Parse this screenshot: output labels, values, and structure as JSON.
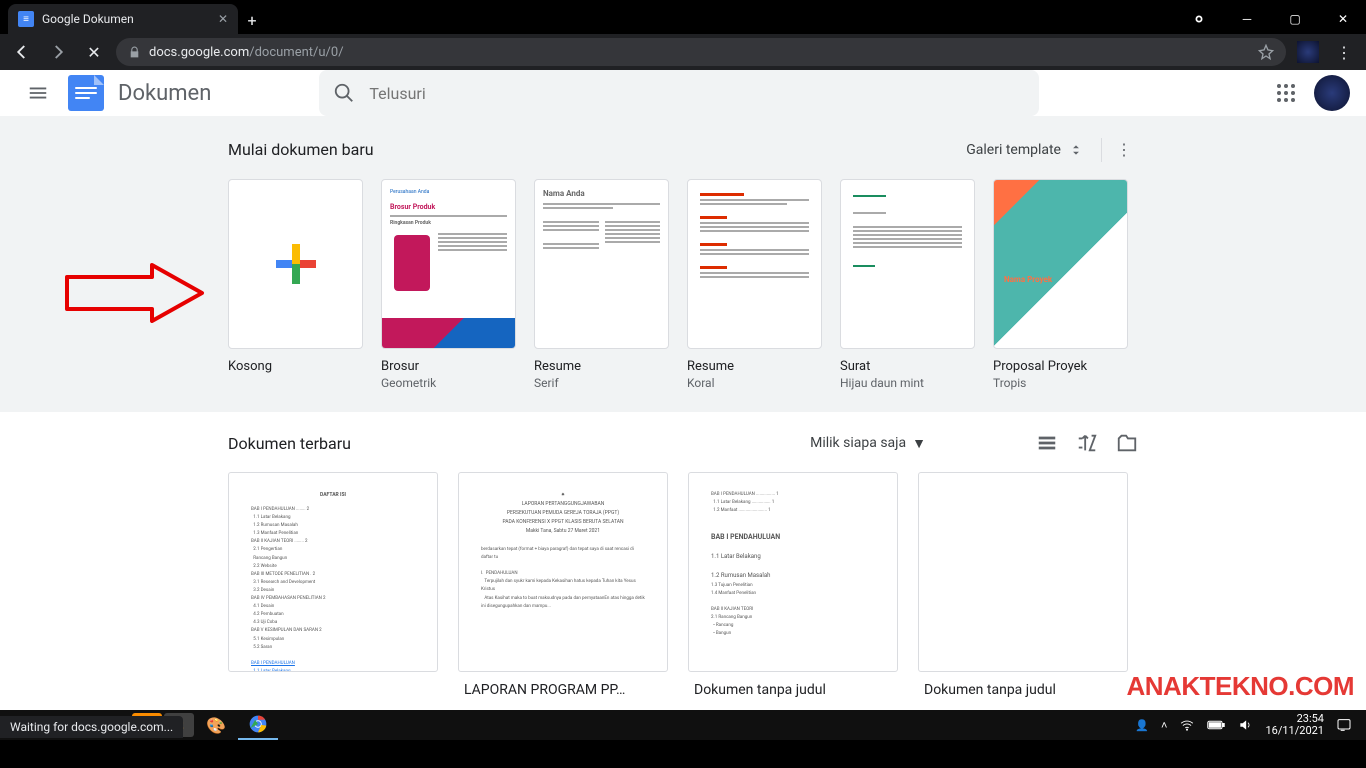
{
  "browser": {
    "tab_title": "Google Dokumen",
    "url_host": "docs.google.com",
    "url_path": "/document/u/0/",
    "status": "Waiting for docs.google.com..."
  },
  "header": {
    "product": "Dokumen",
    "search_placeholder": "Telusuri"
  },
  "templates": {
    "heading": "Mulai dokumen baru",
    "gallery_label": "Galeri template",
    "items": [
      {
        "title": "Kosong",
        "subtitle": ""
      },
      {
        "title": "Brosur",
        "subtitle": "Geometrik"
      },
      {
        "title": "Resume",
        "subtitle": "Serif"
      },
      {
        "title": "Resume",
        "subtitle": "Koral"
      },
      {
        "title": "Surat",
        "subtitle": "Hijau daun mint"
      },
      {
        "title": "Proposal Proyek",
        "subtitle": "Tropis"
      }
    ]
  },
  "recent": {
    "heading": "Dokumen terbaru",
    "owner_filter": "Milik siapa saja",
    "docs": [
      {
        "title": ""
      },
      {
        "title": "LAPORAN PROGRAM PP…"
      },
      {
        "title": "Dokumen tanpa judul"
      },
      {
        "title": "Dokumen tanpa judul"
      }
    ]
  },
  "watermark": "ANAKTEKNO.COM",
  "taskbar": {
    "time": "23:54",
    "date": "16/11/2021"
  },
  "thumb_text": {
    "tropis_label": "Nama Proyek",
    "serif_title": "Nama Anda",
    "brosur_title": "Brosur Produk",
    "brosur_company": "Perusahaan Anda",
    "brosur_section": "Ringkasan Produk",
    "doc3_h1": "BAB I PENDAHULUAN",
    "doc3_h2": "1.1 Latar Belakang",
    "doc3_h3": "1.2 Rumusan Masalah",
    "laporan_l1": "LAPORAN PERTANGGUNGJAWABAN",
    "laporan_l2": "PERSEKUTUAN PEMUDA GEREJA TORAJA (PPGT)"
  },
  "colors": {
    "accent": "#4285f4",
    "bg_strip": "#f1f3f4",
    "watermark": "#e53935"
  }
}
